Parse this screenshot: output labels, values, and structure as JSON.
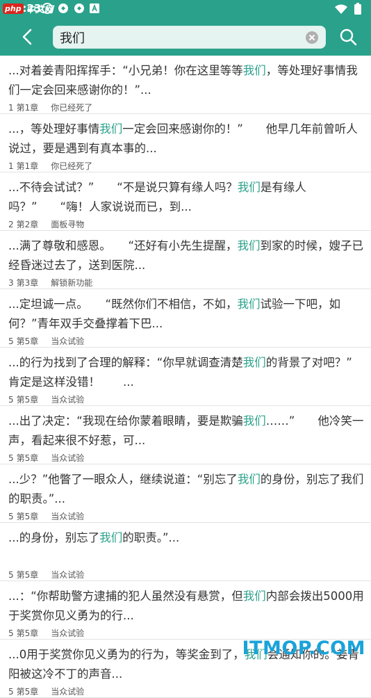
{
  "status_bar": {
    "time": "4:23"
  },
  "watermark": {
    "badge": "php",
    "site": "中文网",
    "bottom": "ITMOP.COM"
  },
  "search": {
    "query": "我们"
  },
  "results": [
    {
      "pre": "...对着姜青阳挥挥手：“小兄弟！你在这里等等",
      "hl": "我们",
      "post": "，等处理好事情我们一定会回来感谢你的！”...",
      "chapter_no": "1",
      "chapter": "第1章",
      "title": "你已经死了"
    },
    {
      "pre": "...，等处理好事情",
      "hl": "我们",
      "post": "一定会回来感谢你的！”　　他早几年前曾听人说过，要是遇到有真本事的...",
      "chapter_no": "1",
      "chapter": "第1章",
      "title": "你已经死了"
    },
    {
      "pre": "...不待会试试？”　　“不是说只算有缘人吗？",
      "hl": "我们",
      "post": "是有缘人吗？”　　“嗨！人家说说而已，到...",
      "chapter_no": "2",
      "chapter": "第2章",
      "title": "面板寻物"
    },
    {
      "pre": "...满了尊敬和感恩。　　“还好有小先生提醒，",
      "hl": "我们",
      "post": "到家的时候，嫂子已经昏迷过去了，送到医院...",
      "chapter_no": "3",
      "chapter": "第3章",
      "title": "解锁新功能"
    },
    {
      "pre": "...定坦诚一点。　　“既然你们不相信，不如，",
      "hl": "我们",
      "post": "试验一下吧，如何？”青年双手交叠撑着下巴...",
      "chapter_no": "5",
      "chapter": "第5章",
      "title": "当众试验"
    },
    {
      "pre": "...的行为找到了合理的解释：“你早就调查清楚",
      "hl": "我们",
      "post": "的背景了对吧？”　　肯定是这样没错！　　...",
      "chapter_no": "5",
      "chapter": "第5章",
      "title": "当众试验"
    },
    {
      "pre": "...出了决定：“我现在给你蒙着眼睛，要是欺骗",
      "hl": "我们",
      "post": "……”　　他冷笑一声，看起来很不好惹，可...",
      "chapter_no": "5",
      "chapter": "第5章",
      "title": "当众试验"
    },
    {
      "pre": "...少？”他瞥了一眼众人，继续说道：“别忘了",
      "hl": "我们",
      "post": "的身份，别忘了我们的职责。”...",
      "chapter_no": "5",
      "chapter": "第5章",
      "title": "当众试验"
    },
    {
      "pre": "...的身份，别忘了",
      "hl": "我们",
      "post": "的职责。”...",
      "chapter_no": "5",
      "chapter": "第5章",
      "title": "当众试验"
    },
    {
      "pre": "...：“你帮助警方逮捕的犯人虽然没有悬赏，但",
      "hl": "我们",
      "post": "内部会拨出5000用于奖赏你见义勇为的行...",
      "chapter_no": "5",
      "chapter": "第5章",
      "title": "当众试验"
    },
    {
      "pre": "...0用于奖赏你见义勇为的行为，等奖金到了，",
      "hl": "我们",
      "post": "会通知你的。”姜青阳被这冷不丁的声音...",
      "chapter_no": "5",
      "chapter": "第5章",
      "title": "当众试验"
    }
  ],
  "colors": {
    "primary": "#2aa18b",
    "highlight": "#2aa18b"
  }
}
